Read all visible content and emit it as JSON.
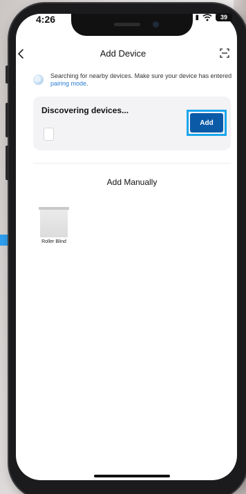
{
  "status_bar": {
    "time": "4:26",
    "battery": "39"
  },
  "header": {
    "title": "Add Device",
    "back_icon": "chevron-left-icon",
    "scan_icon": "scan-icon"
  },
  "hint": {
    "text": "Searching for nearby devices. Make sure your device has entered ",
    "link": "pairing mode",
    "suffix": "."
  },
  "discovery": {
    "title": "Discovering devices...",
    "add_label": "Add",
    "highlight_color": "#1aa6ee",
    "button_color": "#0b5aa8"
  },
  "manual": {
    "title": "Add Manually",
    "items": [
      {
        "label": "Roller Blind",
        "icon": "roller-blind-icon"
      }
    ]
  }
}
